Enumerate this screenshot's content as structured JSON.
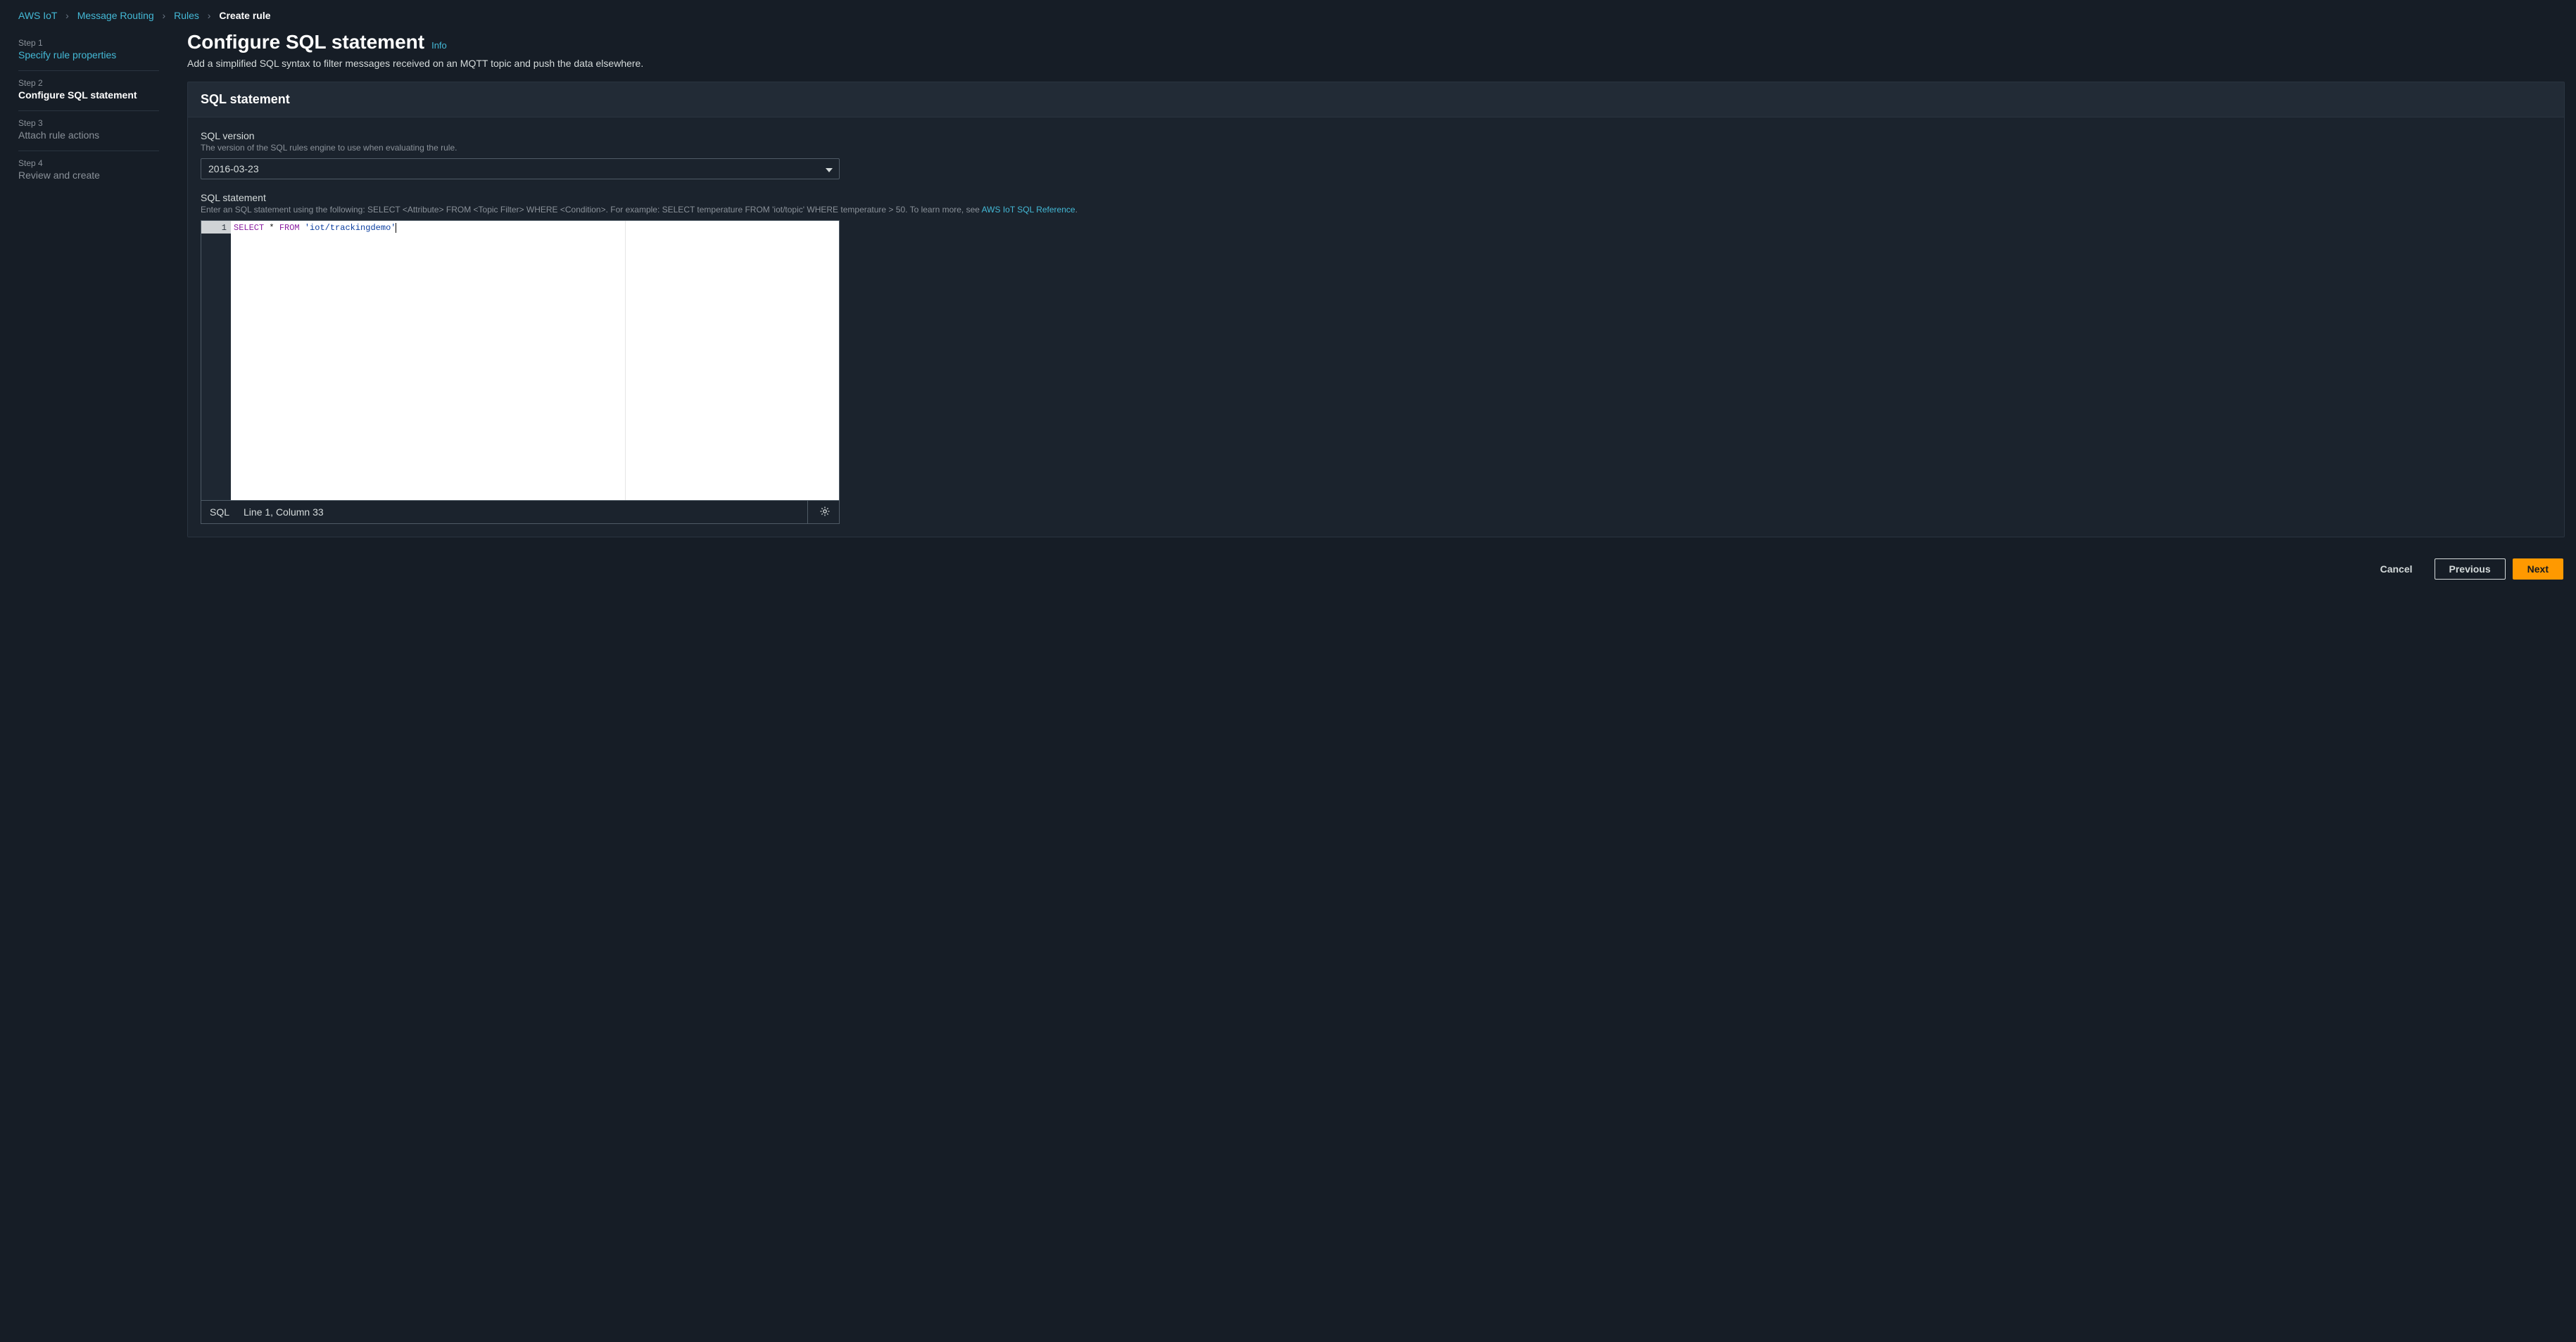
{
  "breadcrumbs": {
    "items": [
      "AWS IoT",
      "Message Routing",
      "Rules",
      "Create rule"
    ]
  },
  "sidebar": {
    "steps": [
      {
        "num": "Step 1",
        "title": "Specify rule properties"
      },
      {
        "num": "Step 2",
        "title": "Configure SQL statement"
      },
      {
        "num": "Step 3",
        "title": "Attach rule actions"
      },
      {
        "num": "Step 4",
        "title": "Review and create"
      }
    ]
  },
  "header": {
    "title": "Configure SQL statement",
    "info": "Info",
    "subtitle": "Add a simplified SQL syntax to filter messages received on an MQTT topic and push the data elsewhere."
  },
  "panel": {
    "title": "SQL statement",
    "version": {
      "label": "SQL version",
      "hint": "The version of the SQL rules engine to use when evaluating the rule.",
      "value": "2016-03-23"
    },
    "statement": {
      "label": "SQL statement",
      "hint_prefix": "Enter an SQL statement using the following: SELECT <Attribute> FROM <Topic Filter> WHERE <Condition>. For example: SELECT temperature FROM 'iot/topic' WHERE temperature > 50. To learn more, see ",
      "hint_link": "AWS IoT SQL Reference",
      "hint_suffix": ".",
      "line_number": "1",
      "kw_select": "SELECT",
      "star": " * ",
      "kw_from": "FROM",
      "space": " ",
      "str": "'iot/trackingdemo'",
      "status_lang": "SQL",
      "status_pos": "Line 1, Column 33"
    }
  },
  "footer": {
    "cancel": "Cancel",
    "previous": "Previous",
    "next": "Next"
  }
}
